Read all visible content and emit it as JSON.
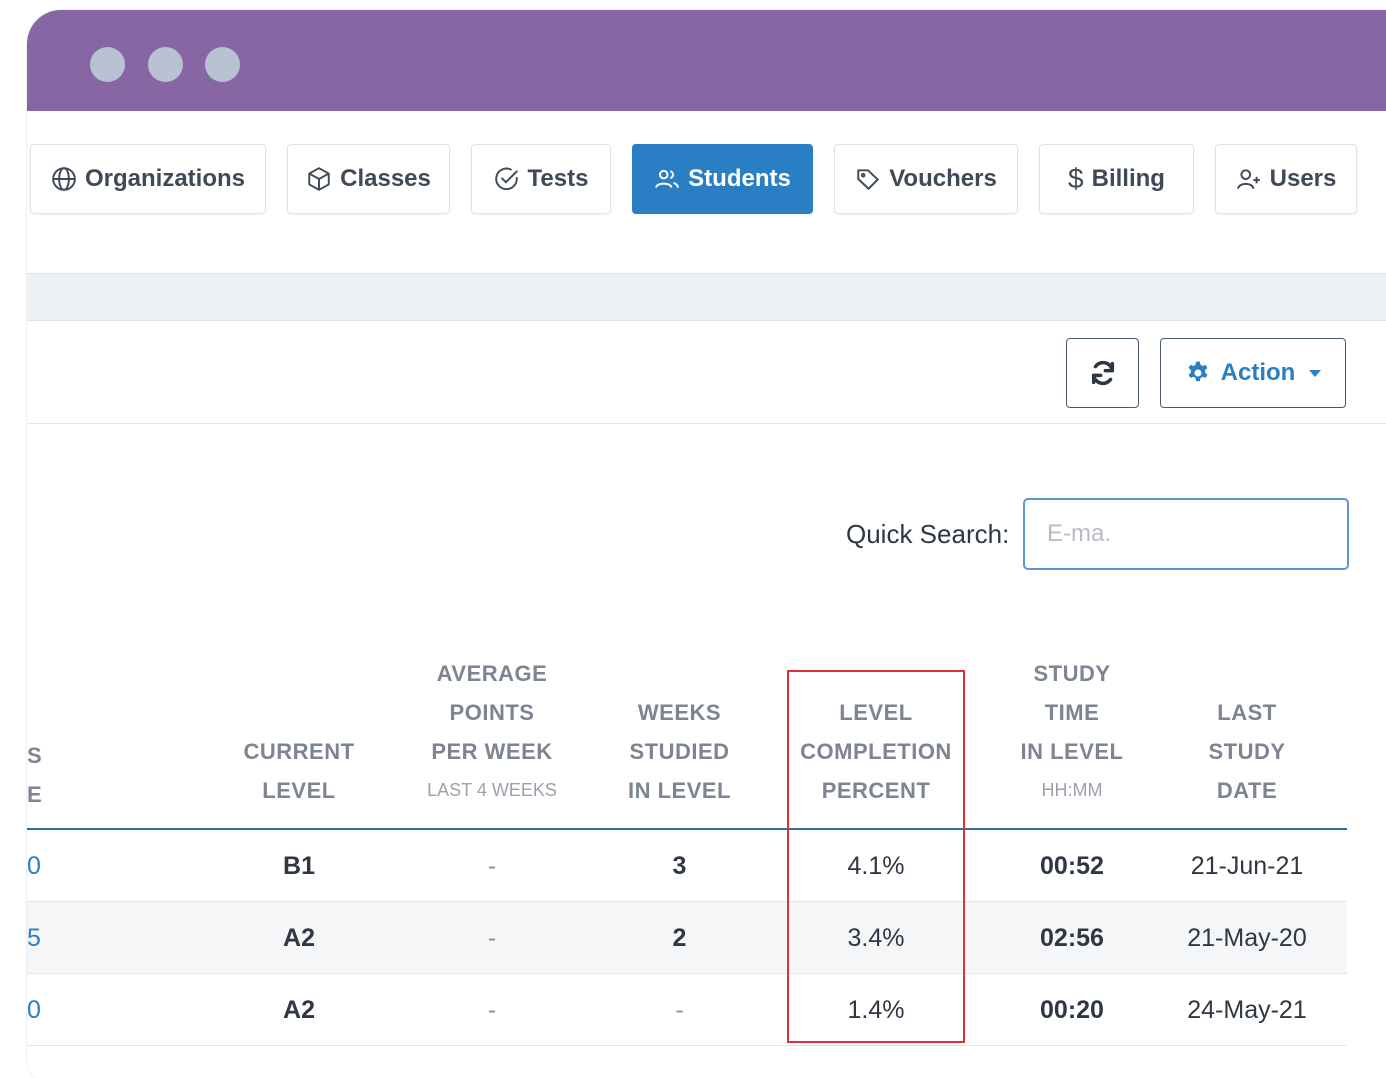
{
  "nav": {
    "items": [
      {
        "label": "Organizations",
        "icon": "globe-icon"
      },
      {
        "label": "Classes",
        "icon": "cube-icon"
      },
      {
        "label": "Tests",
        "icon": "check-circle-icon"
      },
      {
        "label": "Students",
        "icon": "users-icon",
        "active": true
      },
      {
        "label": "Vouchers",
        "icon": "tag-icon"
      },
      {
        "label": "Billing",
        "icon": "dollar-icon"
      },
      {
        "label": "Users",
        "icon": "user-plus-icon"
      }
    ]
  },
  "toolbar": {
    "refresh_icon": "refresh-icon",
    "action_label": "Action"
  },
  "search": {
    "label": "Quick Search:",
    "placeholder": "E-ma."
  },
  "table": {
    "left_fragment_headers": [
      "S",
      "E"
    ],
    "headers": [
      {
        "lines": [
          "CURRENT",
          "LEVEL"
        ],
        "sub": ""
      },
      {
        "lines": [
          "AVERAGE",
          "POINTS",
          "PER WEEK"
        ],
        "sub": "LAST 4 WEEKS"
      },
      {
        "lines": [
          "WEEKS",
          "STUDIED",
          "IN LEVEL"
        ],
        "sub": ""
      },
      {
        "lines": [
          "LEVEL",
          "COMPLETION",
          "PERCENT"
        ],
        "sub": ""
      },
      {
        "lines": [
          "STUDY",
          "TIME",
          "IN LEVEL"
        ],
        "sub": "HH:MM"
      },
      {
        "lines": [
          "LAST",
          "STUDY",
          "DATE"
        ],
        "sub": ""
      }
    ],
    "rows": [
      {
        "fragment": "0",
        "current_level": "B1",
        "avg_points": "-",
        "weeks": "3",
        "completion": "4.1%",
        "study_time": "00:52",
        "last_date": "21-Jun-21"
      },
      {
        "fragment": "5",
        "current_level": "A2",
        "avg_points": "-",
        "weeks": "2",
        "completion": "3.4%",
        "study_time": "02:56",
        "last_date": "21-May-20"
      },
      {
        "fragment": "0",
        "current_level": "A2",
        "avg_points": "-",
        "weeks": "-",
        "completion": "1.4%",
        "study_time": "00:20",
        "last_date": "24-May-21"
      }
    ]
  },
  "colors": {
    "titlebar": "#8766a4",
    "accent": "#2a7fc4",
    "highlight": "#e0303a"
  }
}
